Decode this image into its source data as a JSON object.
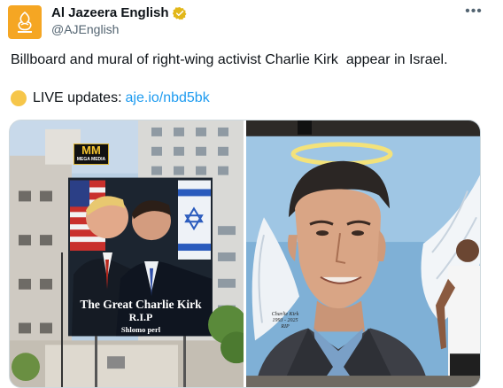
{
  "account": {
    "display_name": "Al Jazeera English",
    "handle": "@AJEnglish",
    "avatar_icon": "al-jazeera-logo-icon",
    "verified_icon": "gold-verified-badge-icon",
    "more_icon": "more-options-icon"
  },
  "tweet": {
    "text": "Billboard and mural of right-wing activist Charlie Kirk  appear in Israel.",
    "live_label": "LIVE updates:",
    "live_link": "aje.io/nbd5bk",
    "live_icon": "yellow-circle-icon"
  },
  "media": {
    "left_image": {
      "billboard_line1": "The Great Charlie Kirk",
      "billboard_line2": "R.I.P",
      "billboard_line3": "Shlomo perl",
      "mega_logo": "MM",
      "mega_logo_sub": "MEGA MEDIA"
    },
    "right_image": {
      "signature_line1": "Charlie Kirk",
      "signature_line2": "1993 - 2025",
      "signature_line3": "RIP"
    }
  },
  "colors": {
    "link": "#1d9bf0",
    "brand": "#f5a623",
    "secondary_text": "#536471"
  }
}
